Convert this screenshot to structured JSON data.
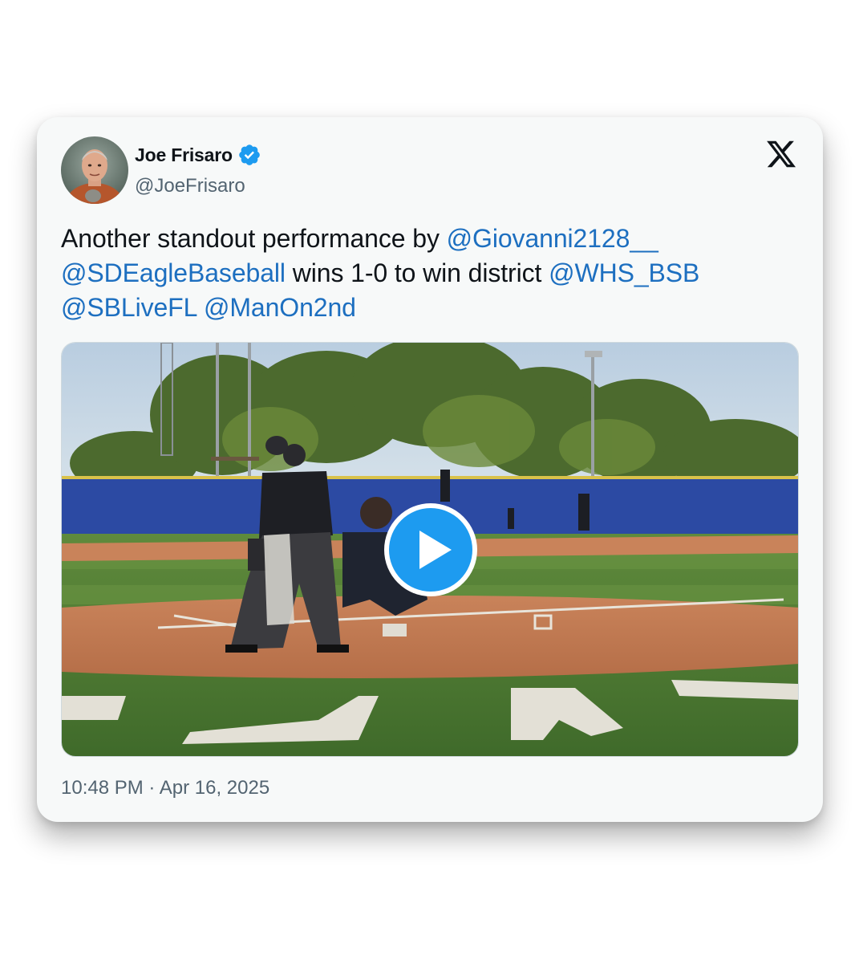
{
  "author": {
    "display_name": "Joe Frisaro",
    "handle": "@JoeFrisaro",
    "verified": true
  },
  "tweet": {
    "segments": [
      {
        "text": "Another standout performance by ",
        "type": "text"
      },
      {
        "text": "@Giovanni2128__",
        "type": "mention"
      },
      {
        "text": " ",
        "type": "text"
      },
      {
        "text": "@SDEagleBaseball",
        "type": "mention"
      },
      {
        "text": " wins 1-0 to win district ",
        "type": "text"
      },
      {
        "text": "@WHS_BSB",
        "type": "mention"
      },
      {
        "text": " ",
        "type": "text"
      },
      {
        "text": "@SBLiveFL",
        "type": "mention"
      },
      {
        "text": " ",
        "type": "text"
      },
      {
        "text": "@ManOn2nd",
        "type": "mention"
      }
    ],
    "timestamp": "10:48 PM · Apr 16, 2025"
  },
  "media": {
    "kind": "video",
    "description_icon": "play-icon"
  },
  "icons": {
    "brand": "x-logo-icon",
    "verified": "verified-badge-icon",
    "play": "play-icon"
  },
  "colors": {
    "mention": "#1d6fc0",
    "verified": "#1d9bf0",
    "play_button": "#1d9bf0",
    "text": "#0f1419",
    "secondary_text": "#536471"
  }
}
